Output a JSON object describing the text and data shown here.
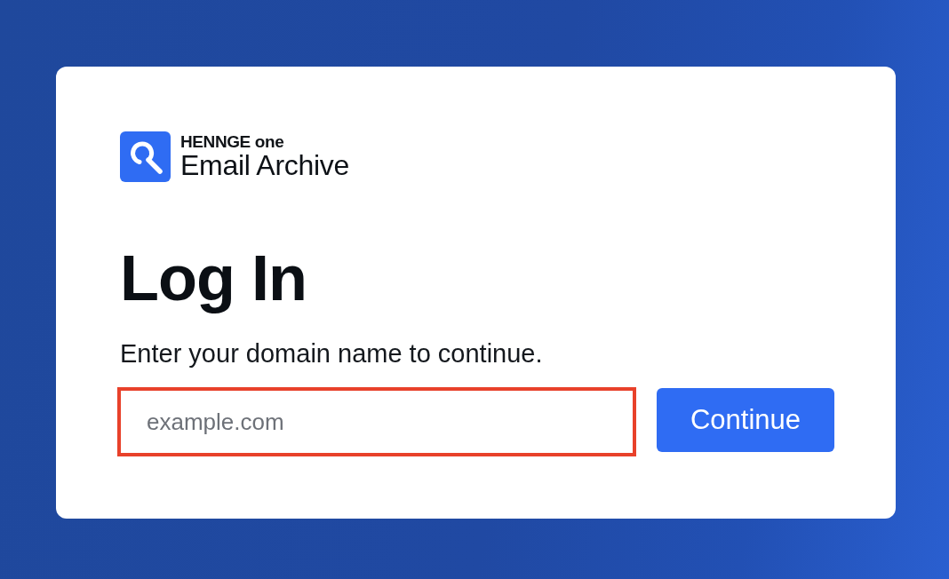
{
  "brand": {
    "company": "HENNGE one",
    "product": "Email Archive"
  },
  "heading": "Log In",
  "instructions": "Enter your domain name to continue.",
  "domain_field": {
    "placeholder": "example.com",
    "highlighted": true
  },
  "continue_button": {
    "label": "Continue"
  }
}
